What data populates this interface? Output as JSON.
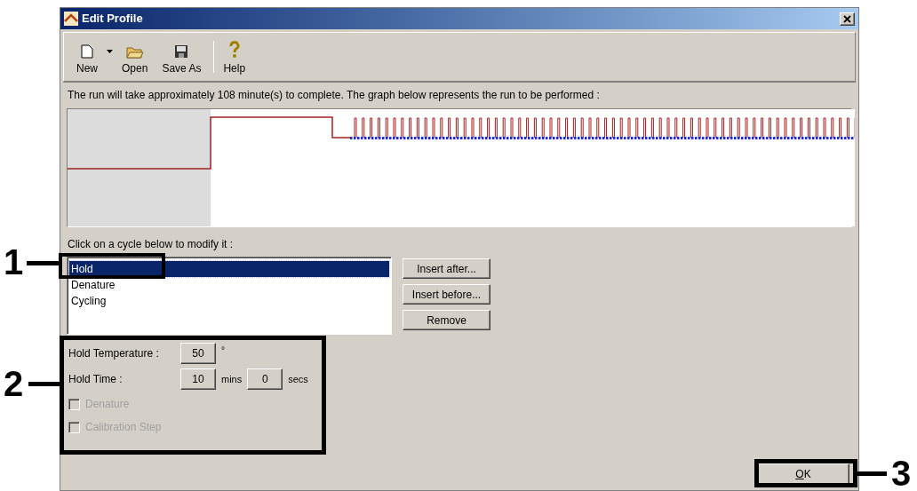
{
  "window": {
    "title": "Edit Profile"
  },
  "toolbar": [
    {
      "label": "New",
      "kind": "new"
    },
    {
      "label": "Open",
      "kind": "open"
    },
    {
      "label": "Save As",
      "kind": "save"
    },
    {
      "label": "Help",
      "kind": "help"
    }
  ],
  "message": "The run will take approximately 108 minute(s) to complete. The graph below represents the run to be performed :",
  "cycles": {
    "label": "Click on a cycle below to modify it :",
    "items": [
      {
        "label": "Hold",
        "selected": true
      },
      {
        "label": "Denature",
        "selected": false
      },
      {
        "label": "Cycling",
        "selected": false
      }
    ]
  },
  "cycle_buttons": [
    "Insert after...",
    "Insert before...",
    "Remove"
  ],
  "settings": {
    "temperature_label": "Hold Temperature :",
    "temperature": "50",
    "temperature_unit": "°",
    "time_label": "Hold Time :",
    "minutes": "10",
    "minutes_unit": "mins",
    "seconds": "0",
    "seconds_unit": "secs",
    "options": [
      {
        "label": "Denature",
        "checked": false,
        "disabled": true
      },
      {
        "label": "Calibration Step",
        "checked": false,
        "disabled": true
      }
    ]
  },
  "ok_button": "OK",
  "callouts": [
    "1",
    "2",
    "3"
  ]
}
